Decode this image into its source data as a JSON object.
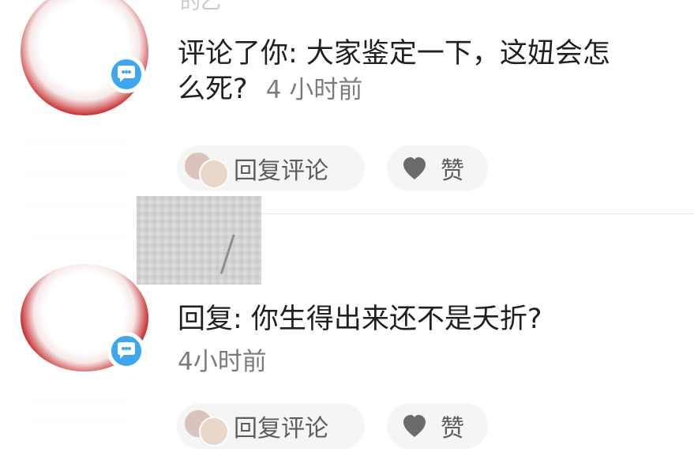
{
  "first_comment": {
    "partial_name": "的乙",
    "comment_line_1": "评论了你: 大家鉴定一下，这妞会怎",
    "comment_line_2": "么死?",
    "time": "4 小时前",
    "actions": {
      "reply": "回复评论",
      "like": "赞"
    }
  },
  "second_comment": {
    "comment": "回复: 你生得出来还不是夭折?",
    "time": "4小时前",
    "actions": {
      "reply": "回复评论",
      "like": "赞"
    }
  },
  "icons": {
    "badge": "chat-bubble-icon",
    "like": "heart-icon",
    "reply_avatar": "reply-avatar-icon"
  },
  "colors": {
    "badge": "#3ba7f5",
    "pill_bg": "#f5f5f5",
    "avatar_ring": "#c41414"
  }
}
